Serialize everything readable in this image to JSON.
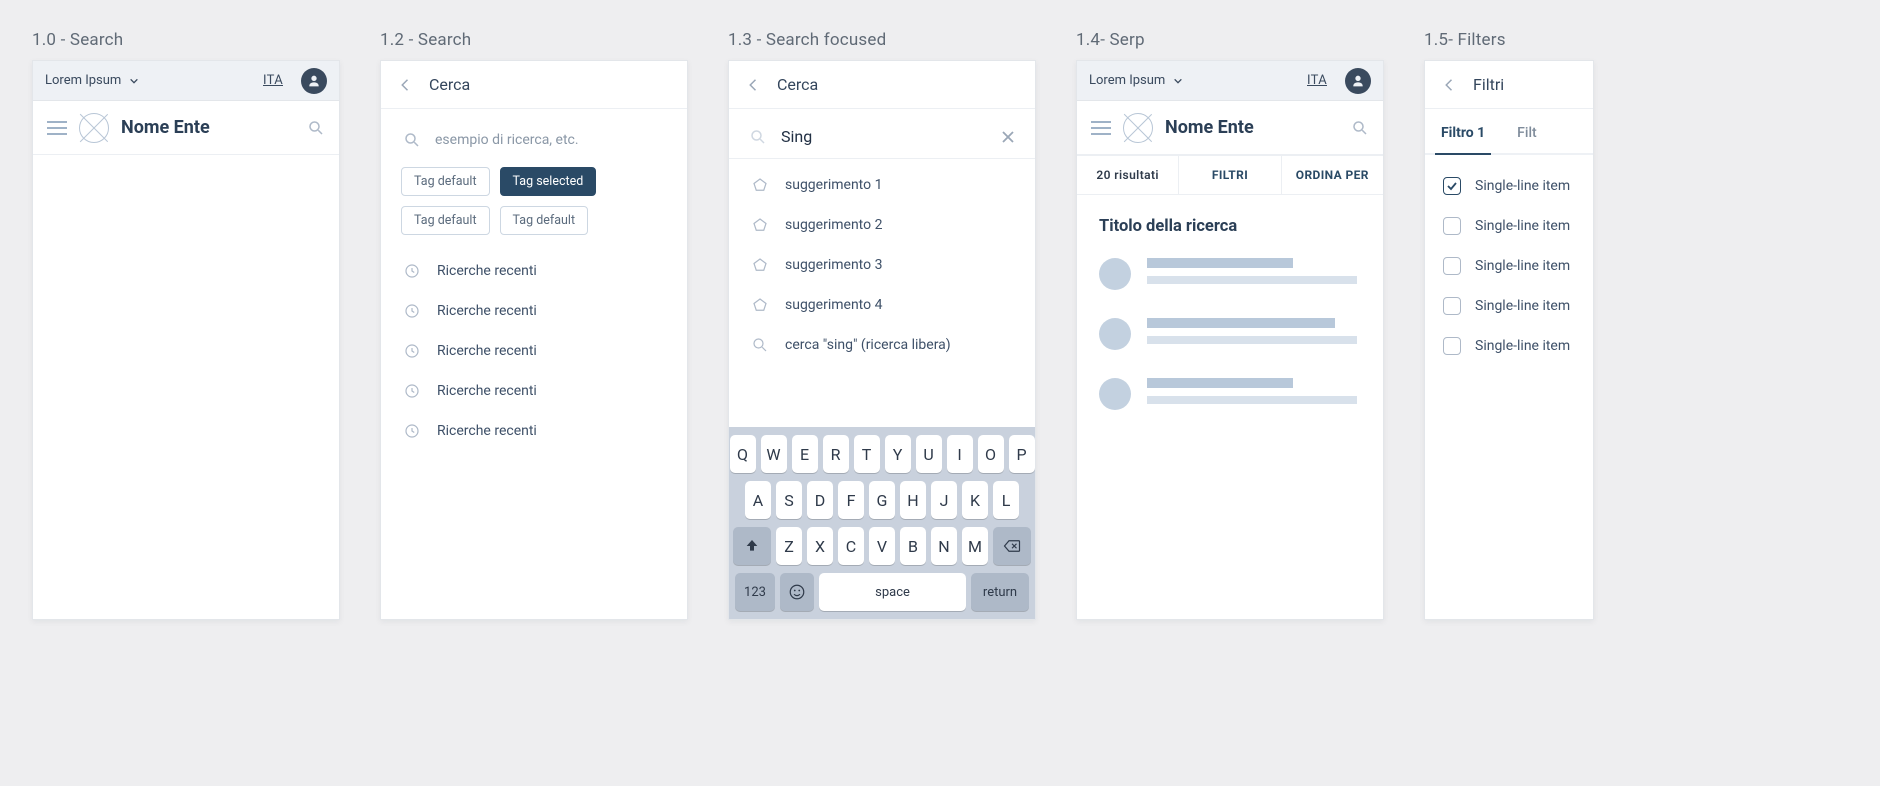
{
  "screens": {
    "s10": {
      "label": "1.0 - Search",
      "slim_brand": "Lorem Ipsum",
      "lang": "ITA",
      "brand": "Nome Ente"
    },
    "s12": {
      "label": "1.2 - Search",
      "title": "Cerca",
      "placeholder": "esempio di ricerca, etc.",
      "tags": [
        "Tag default",
        "Tag selected",
        "Tag default",
        "Tag default"
      ],
      "recent_label": "Ricerche recenti"
    },
    "s13": {
      "label": "1.3 - Search focused",
      "title": "Cerca",
      "value": "Sing",
      "suggestions": [
        "suggerimento 1",
        "suggerimento 2",
        "suggerimento 3",
        "suggerimento 4"
      ],
      "freesearch": "cerca \"sing\" (ricerca libera)"
    },
    "s14": {
      "label": "1.4- Serp",
      "slim_brand": "Lorem Ipsum",
      "lang": "ITA",
      "brand": "Nome Ente",
      "tab_count": "20 risultati",
      "tab_filters": "FILTRI",
      "tab_sort": "ORDINA PER",
      "title": "Titolo della ricerca"
    },
    "s15": {
      "label": "1.5- Filters",
      "title": "Filtri",
      "tab1": "Filtro 1",
      "tab2": "Filt",
      "item": "Single-line item"
    }
  },
  "keyboard": {
    "r1": [
      "Q",
      "W",
      "E",
      "R",
      "T",
      "Y",
      "U",
      "I",
      "O",
      "P"
    ],
    "r2": [
      "A",
      "S",
      "D",
      "F",
      "G",
      "H",
      "J",
      "K",
      "L"
    ],
    "r3": [
      "Z",
      "X",
      "C",
      "V",
      "B",
      "N",
      "M"
    ],
    "num": "123",
    "space": "space",
    "return": "return"
  }
}
